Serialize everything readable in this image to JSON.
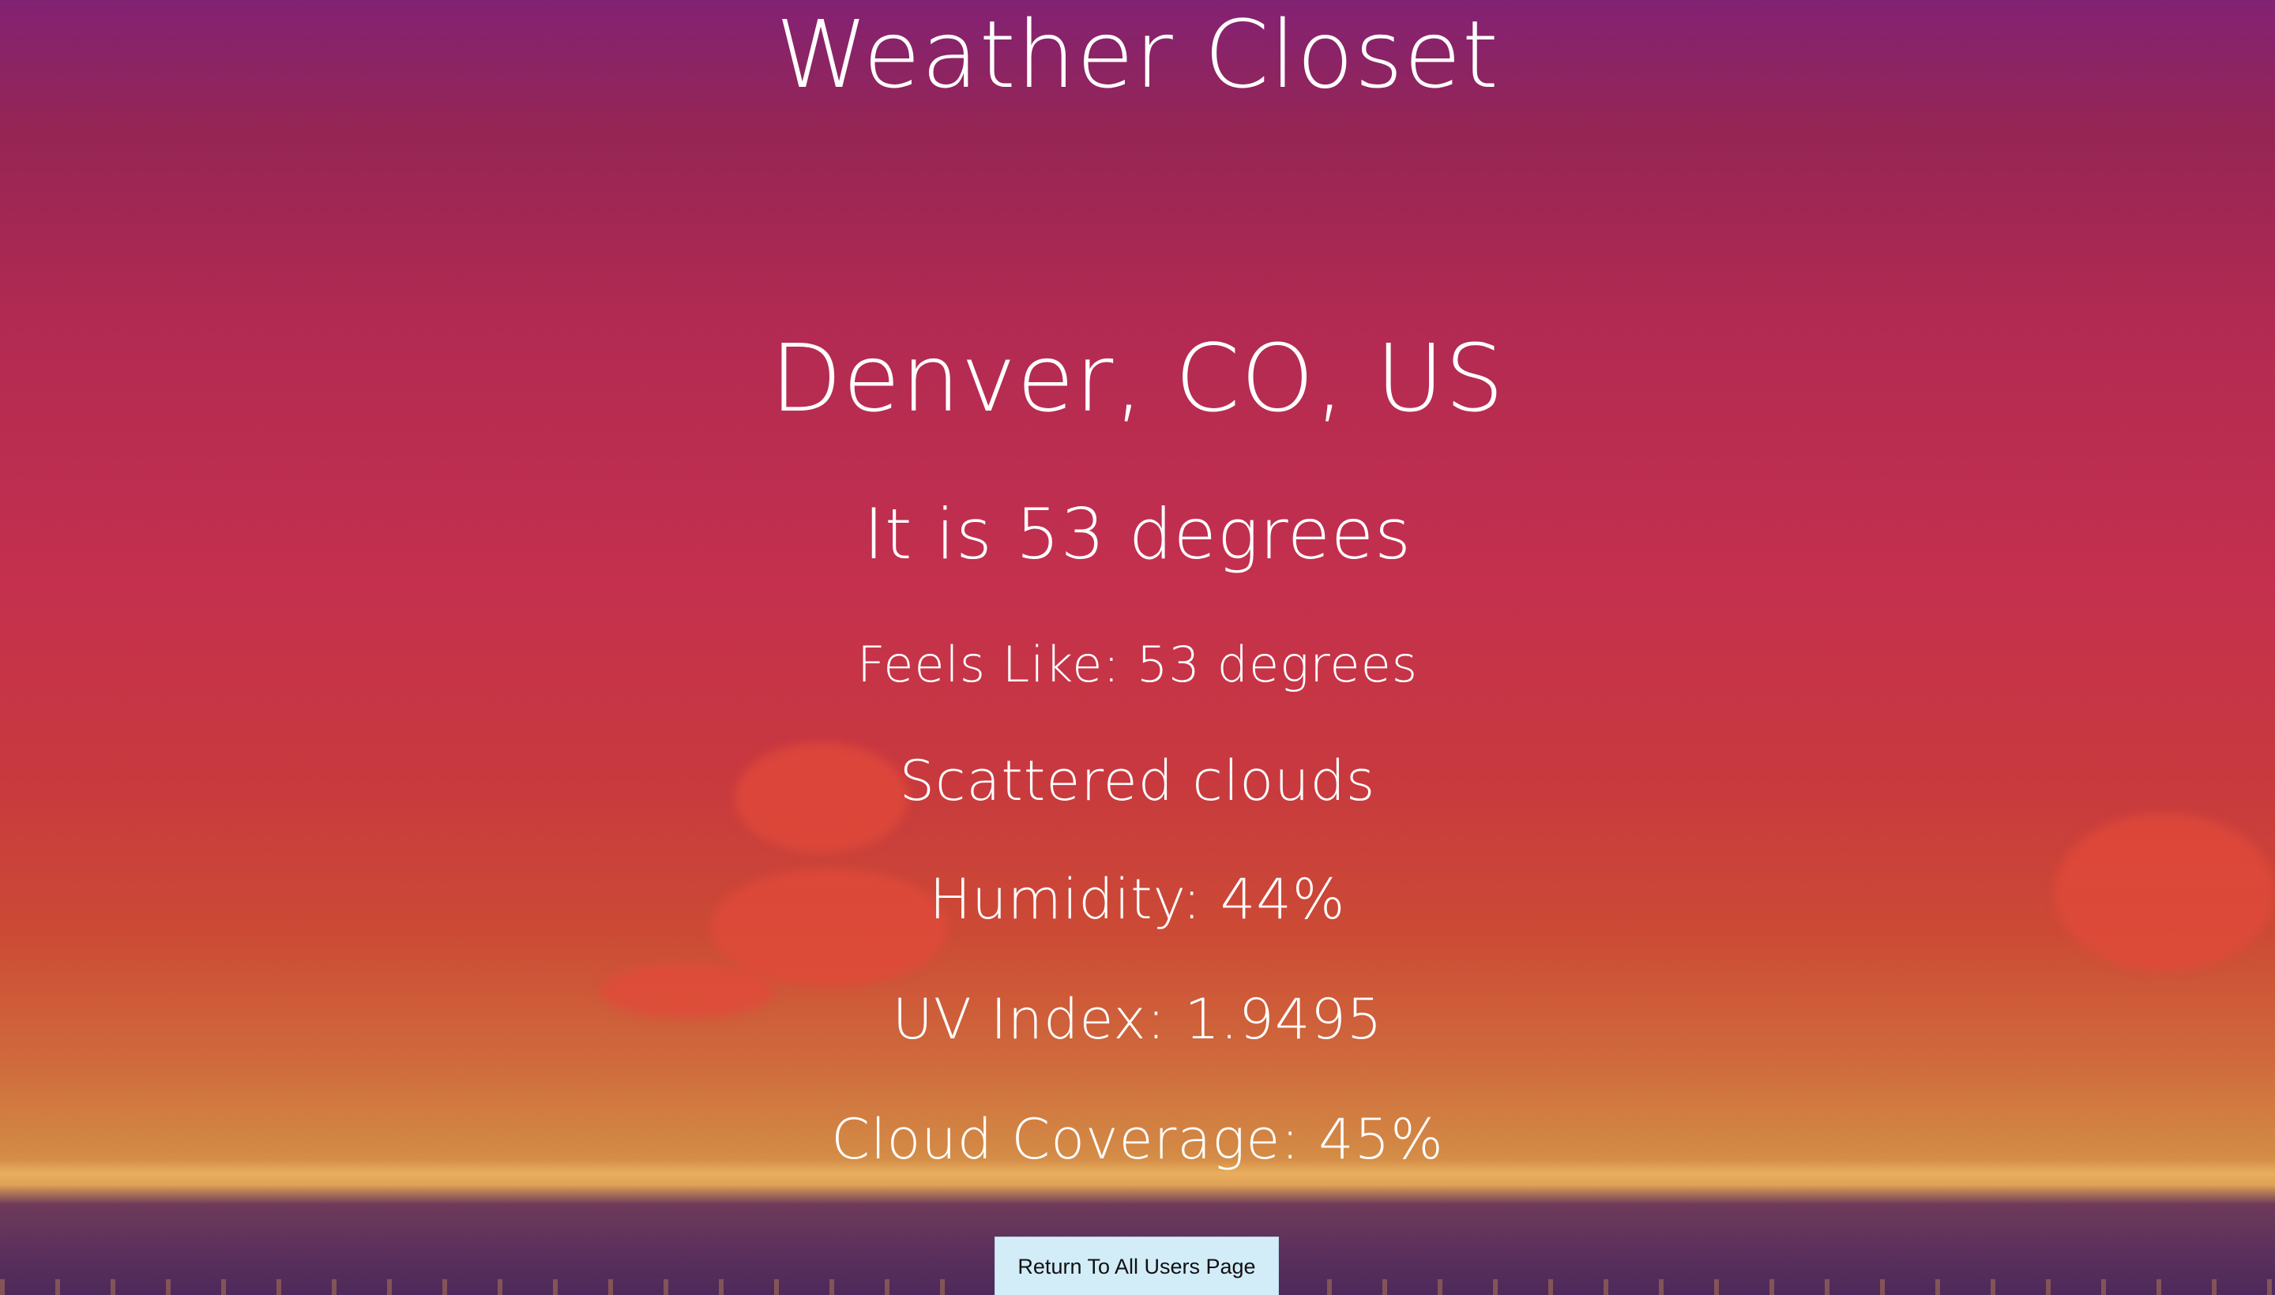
{
  "app": {
    "title": "Weather Closet"
  },
  "weather": {
    "location": "Denver, CO, US",
    "temperature_text": "It is 53 degrees",
    "feels_like_text": "Feels Like: 53 degrees",
    "description": "Scattered clouds",
    "humidity_text": "Humidity: 44%",
    "uv_index_text": "UV Index: 1.9495",
    "cloud_coverage_text": "Cloud Coverage: 45%"
  },
  "actions": {
    "return_label": "Return To All Users Page"
  },
  "colors": {
    "sky_top": "#832274",
    "sky_mid": "#c4304e",
    "sky_low": "#cf6a3c",
    "horizon": "#dca055",
    "ground": "#4d2a5a",
    "button_bg": "#d2ecf8"
  }
}
